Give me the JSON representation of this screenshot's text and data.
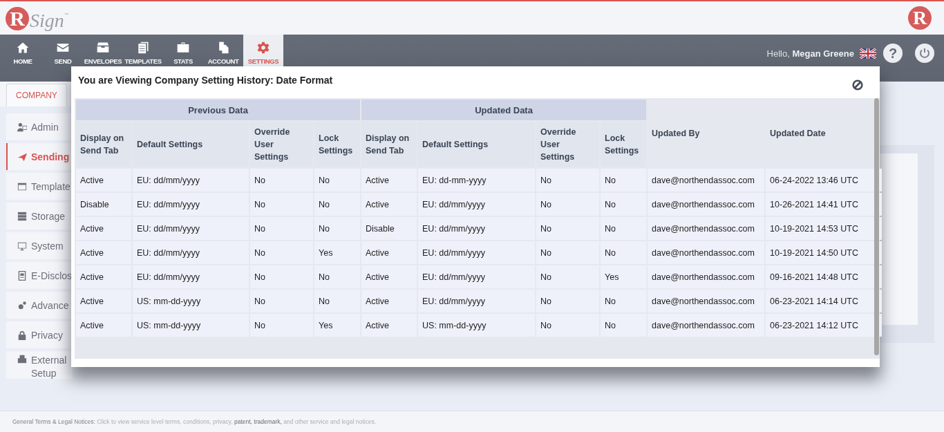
{
  "logo": {
    "mark": "R",
    "word": "Sign",
    "tm": "™"
  },
  "corner_logo": {
    "mark": "R"
  },
  "nav": [
    {
      "label": "HOME",
      "selected": false
    },
    {
      "label": "SEND",
      "selected": false
    },
    {
      "label": "ENVELOPES",
      "selected": false
    },
    {
      "label": "TEMPLATES",
      "selected": false
    },
    {
      "label": "STATS",
      "selected": false
    },
    {
      "label": "ACCOUNT",
      "selected": false
    },
    {
      "label": "SETTINGS",
      "selected": true
    }
  ],
  "user": {
    "greeting": "Hello,",
    "name": "Megan Greene",
    "help": "?"
  },
  "tabs": [
    {
      "label": "COMPANY",
      "selected": true
    }
  ],
  "sidebar": {
    "items": [
      {
        "label": "Admin",
        "selected": false
      },
      {
        "label": "Sending",
        "selected": true
      },
      {
        "label": "Template",
        "selected": false
      },
      {
        "label": "Storage",
        "selected": false
      },
      {
        "label": "System",
        "selected": false
      },
      {
        "label": "E-Disclos",
        "selected": false
      },
      {
        "label": "Advance",
        "selected": false
      },
      {
        "label": "Privacy",
        "selected": false
      },
      {
        "label": "External Setup",
        "selected": false
      }
    ]
  },
  "modal": {
    "title": "You are Viewing Company Setting History: Date Format",
    "table": {
      "groups": [
        "Previous Data",
        "Updated Data"
      ],
      "columns": [
        "Display on Send Tab",
        "Default Settings",
        "Override User Settings",
        "Lock Settings",
        "Display on Send Tab",
        "Default Settings",
        "Override User Settings",
        "Lock Settings",
        "Updated By",
        "Updated Date"
      ],
      "rows": [
        [
          "Active",
          "EU: dd/mm/yyyy",
          "No",
          "No",
          "Active",
          "EU: dd-mm-yyyy",
          "No",
          "No",
          "dave@northendassoc.com",
          "06-24-2022 13:46 UTC"
        ],
        [
          "Disable",
          "EU: dd/mm/yyyy",
          "No",
          "No",
          "Active",
          "EU: dd/mm/yyyy",
          "No",
          "No",
          "dave@northendassoc.com",
          "10-26-2021 14:41 UTC"
        ],
        [
          "Active",
          "EU: dd/mm/yyyy",
          "No",
          "No",
          "Disable",
          "EU: dd/mm/yyyy",
          "No",
          "No",
          "dave@northendassoc.com",
          "10-19-2021 14:53 UTC"
        ],
        [
          "Active",
          "EU: dd/mm/yyyy",
          "No",
          "Yes",
          "Active",
          "EU: dd/mm/yyyy",
          "No",
          "No",
          "dave@northendassoc.com",
          "10-19-2021 14:50 UTC"
        ],
        [
          "Active",
          "EU: dd/mm/yyyy",
          "No",
          "No",
          "Active",
          "EU: dd/mm/yyyy",
          "No",
          "Yes",
          "dave@northendassoc.com",
          "09-16-2021 14:48 UTC"
        ],
        [
          "Active",
          "US: mm-dd-yyyy",
          "No",
          "No",
          "Active",
          "EU: dd/mm/yyyy",
          "No",
          "No",
          "dave@northendassoc.com",
          "06-23-2021 14:14 UTC"
        ],
        [
          "Active",
          "US: mm-dd-yyyy",
          "No",
          "Yes",
          "Active",
          "US: mm-dd-yyyy",
          "No",
          "No",
          "dave@northendassoc.com",
          "06-23-2021 14:12 UTC"
        ]
      ]
    }
  },
  "footer": {
    "title": "General Terms & Legal Notices:",
    "text_before": "Click to view service level terms, conditions, privacy,",
    "link_1": "patent,",
    "link_2": "trademark,",
    "text_after": "and other service and legal notices."
  }
}
